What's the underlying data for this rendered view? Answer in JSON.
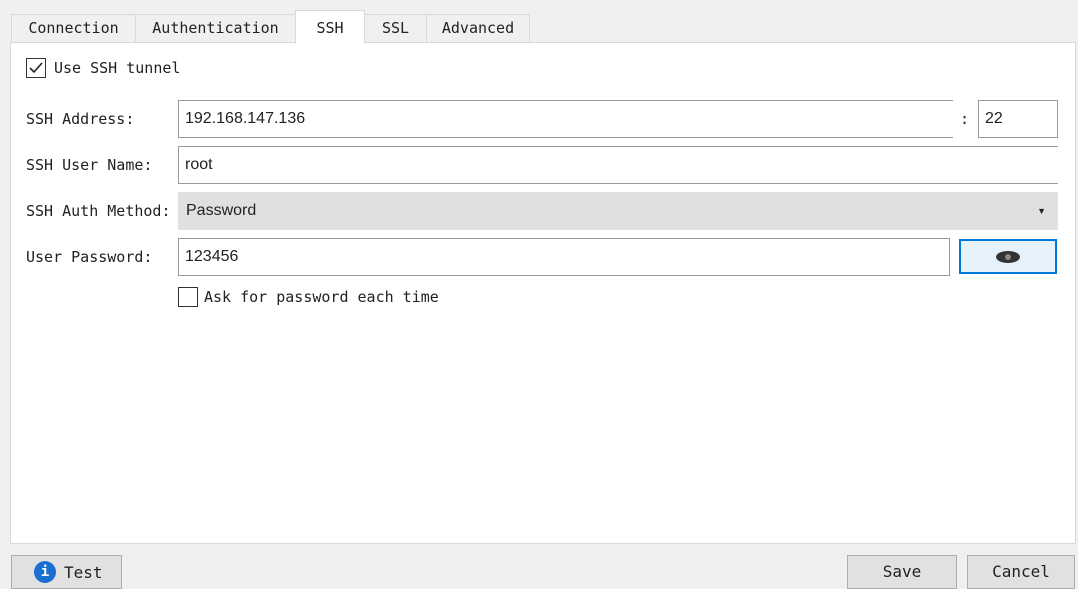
{
  "tabs": [
    {
      "label": "Connection"
    },
    {
      "label": "Authentication"
    },
    {
      "label": "SSH"
    },
    {
      "label": "SSL"
    },
    {
      "label": "Advanced"
    }
  ],
  "ssh": {
    "use_tunnel_label": "Use SSH tunnel",
    "use_tunnel_checked": true,
    "address_label": "SSH Address:",
    "address_value": "192.168.147.136",
    "port_sep": ":",
    "port_value": "22",
    "user_label": "SSH User Name:",
    "user_value": "root",
    "auth_label": "SSH Auth Method:",
    "auth_value": "Password",
    "password_label": "User Password:",
    "password_value": "123456",
    "ask_label": "Ask for password each time",
    "ask_checked": false
  },
  "footer": {
    "test_label": "Test",
    "save_label": "Save",
    "cancel_label": "Cancel"
  }
}
